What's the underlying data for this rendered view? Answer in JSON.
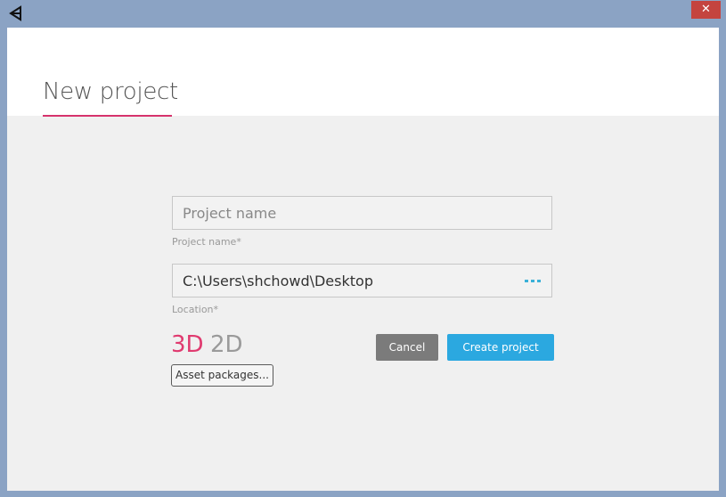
{
  "window": {
    "app_icon": "unity-logo-icon",
    "close_glyph": "✕",
    "close_color": "#c4443f"
  },
  "header": {
    "title": "New project",
    "accent_color": "#d6336c"
  },
  "form": {
    "project_name": {
      "value": "",
      "placeholder": "Project name",
      "label": "Project name*"
    },
    "location": {
      "value": "C:\\Users\\shchowd\\Desktop",
      "label": "Location*",
      "browse_icon": "ellipsis-icon"
    },
    "mode": {
      "options": [
        "3D",
        "2D"
      ],
      "selected": "3D",
      "selected_color": "#e03a6f"
    },
    "asset_packages_label": "Asset packages...",
    "cancel_label": "Cancel",
    "create_label": "Create project",
    "create_color": "#2ba8e0"
  }
}
